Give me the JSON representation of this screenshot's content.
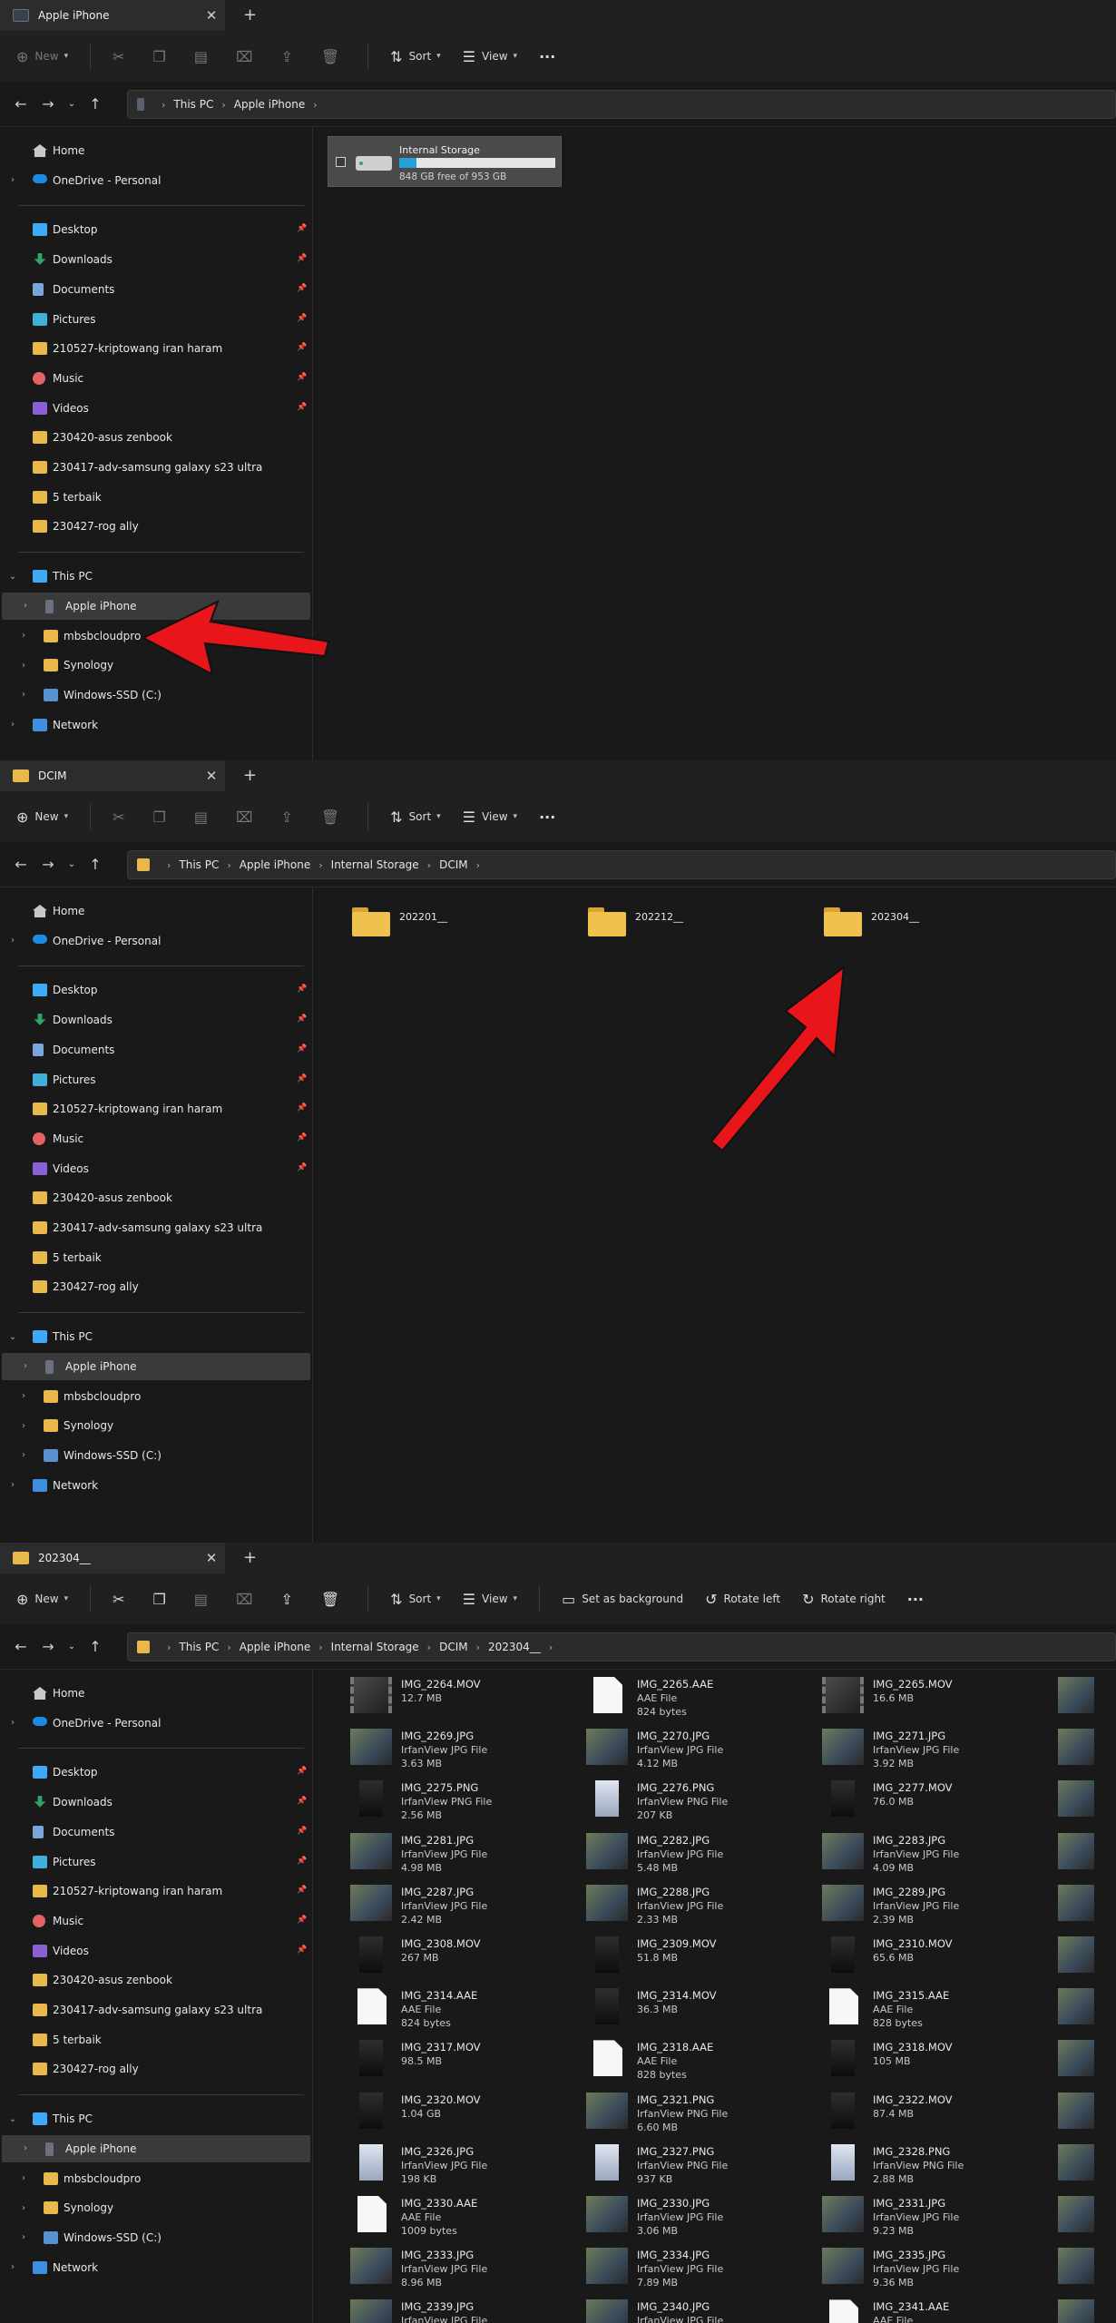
{
  "panels": [
    {
      "tab_title": "Apple iPhone",
      "breadcrumb": [
        "This PC",
        "Apple iPhone"
      ],
      "toolbar": {
        "new_label": "New",
        "sort_label": "Sort",
        "view_label": "View",
        "more_label": "···"
      },
      "drive": {
        "name": "Internal Storage",
        "free_text": "848 GB free of 953 GB",
        "used_fraction": 0.11
      },
      "selected_nav": "Apple iPhone"
    },
    {
      "tab_title": "DCIM",
      "breadcrumb": [
        "This PC",
        "Apple iPhone",
        "Internal Storage",
        "DCIM"
      ],
      "toolbar": {
        "new_label": "New",
        "sort_label": "Sort",
        "view_label": "View",
        "more_label": "···"
      },
      "folders": [
        "202201__",
        "202212__",
        "202304__"
      ],
      "selected_nav": "Apple iPhone"
    },
    {
      "tab_title": "202304__",
      "breadcrumb": [
        "This PC",
        "Apple iPhone",
        "Internal Storage",
        "DCIM",
        "202304__"
      ],
      "toolbar": {
        "new_label": "New",
        "sort_label": "Sort",
        "view_label": "View",
        "set_bg_label": "Set as background",
        "rotate_left_label": "Rotate left",
        "rotate_right_label": "Rotate right",
        "more_label": "···"
      },
      "selected_nav": "Apple iPhone",
      "files": [
        [
          {
            "name": "IMG_2264.MOV",
            "type": "",
            "size": "12.7 MB",
            "thumb": "video"
          },
          {
            "name": "IMG_2265.AAE",
            "type": "AAE File",
            "size": "824 bytes",
            "thumb": "doc"
          },
          {
            "name": "IMG_2265.MOV",
            "type": "",
            "size": "16.6 MB",
            "thumb": "video"
          }
        ],
        [
          {
            "name": "IMG_2269.JPG",
            "type": "IrfanView JPG File",
            "size": "3.63 MB",
            "thumb": "photo"
          },
          {
            "name": "IMG_2270.JPG",
            "type": "IrfanView JPG File",
            "size": "4.12 MB",
            "thumb": "photo"
          },
          {
            "name": "IMG_2271.JPG",
            "type": "IrfanView JPG File",
            "size": "3.92 MB",
            "thumb": "photo"
          }
        ],
        [
          {
            "name": "IMG_2275.PNG",
            "type": "IrfanView PNG File",
            "size": "2.56 MB",
            "thumb": "dark"
          },
          {
            "name": "IMG_2276.PNG",
            "type": "IrfanView PNG File",
            "size": "207 KB",
            "thumb": "screen"
          },
          {
            "name": "IMG_2277.MOV",
            "type": "",
            "size": "76.0 MB",
            "thumb": "dark"
          }
        ],
        [
          {
            "name": "IMG_2281.JPG",
            "type": "IrfanView JPG File",
            "size": "4.98 MB",
            "thumb": "photo"
          },
          {
            "name": "IMG_2282.JPG",
            "type": "IrfanView JPG File",
            "size": "5.48 MB",
            "thumb": "photo"
          },
          {
            "name": "IMG_2283.JPG",
            "type": "IrfanView JPG File",
            "size": "4.09 MB",
            "thumb": "photo"
          }
        ],
        [
          {
            "name": "IMG_2287.JPG",
            "type": "IrfanView JPG File",
            "size": "2.42 MB",
            "thumb": "photo"
          },
          {
            "name": "IMG_2288.JPG",
            "type": "IrfanView JPG File",
            "size": "2.33 MB",
            "thumb": "photo"
          },
          {
            "name": "IMG_2289.JPG",
            "type": "IrfanView JPG File",
            "size": "2.39 MB",
            "thumb": "photo"
          }
        ],
        [
          {
            "name": "IMG_2308.MOV",
            "type": "",
            "size": "267 MB",
            "thumb": "dark"
          },
          {
            "name": "IMG_2309.MOV",
            "type": "",
            "size": "51.8 MB",
            "thumb": "dark"
          },
          {
            "name": "IMG_2310.MOV",
            "type": "",
            "size": "65.6 MB",
            "thumb": "dark"
          }
        ],
        [
          {
            "name": "IMG_2314.AAE",
            "type": "AAE File",
            "size": "824 bytes",
            "thumb": "doc"
          },
          {
            "name": "IMG_2314.MOV",
            "type": "",
            "size": "36.3 MB",
            "thumb": "dark"
          },
          {
            "name": "IMG_2315.AAE",
            "type": "AAE File",
            "size": "828 bytes",
            "thumb": "doc"
          }
        ],
        [
          {
            "name": "IMG_2317.MOV",
            "type": "",
            "size": "98.5 MB",
            "thumb": "dark"
          },
          {
            "name": "IMG_2318.AAE",
            "type": "AAE File",
            "size": "828 bytes",
            "thumb": "doc"
          },
          {
            "name": "IMG_2318.MOV",
            "type": "",
            "size": "105 MB",
            "thumb": "dark"
          }
        ],
        [
          {
            "name": "IMG_2320.MOV",
            "type": "",
            "size": "1.04 GB",
            "thumb": "dark"
          },
          {
            "name": "IMG_2321.PNG",
            "type": "IrfanView PNG File",
            "size": "6.60 MB",
            "thumb": "photo"
          },
          {
            "name": "IMG_2322.MOV",
            "type": "",
            "size": "87.4 MB",
            "thumb": "dark"
          }
        ],
        [
          {
            "name": "IMG_2326.JPG",
            "type": "IrfanView JPG File",
            "size": "198 KB",
            "thumb": "screen"
          },
          {
            "name": "IMG_2327.PNG",
            "type": "IrfanView PNG File",
            "size": "937 KB",
            "thumb": "screen"
          },
          {
            "name": "IMG_2328.PNG",
            "type": "IrfanView PNG File",
            "size": "2.88 MB",
            "thumb": "screen"
          }
        ],
        [
          {
            "name": "IMG_2330.AAE",
            "type": "AAE File",
            "size": "1009 bytes",
            "thumb": "doc"
          },
          {
            "name": "IMG_2330.JPG",
            "type": "IrfanView JPG File",
            "size": "3.06 MB",
            "thumb": "photo"
          },
          {
            "name": "IMG_2331.JPG",
            "type": "IrfanView JPG File",
            "size": "9.23 MB",
            "thumb": "photo"
          }
        ],
        [
          {
            "name": "IMG_2333.JPG",
            "type": "IrfanView JPG File",
            "size": "8.96 MB",
            "thumb": "photo"
          },
          {
            "name": "IMG_2334.JPG",
            "type": "IrfanView JPG File",
            "size": "7.89 MB",
            "thumb": "photo"
          },
          {
            "name": "IMG_2335.JPG",
            "type": "IrfanView JPG File",
            "size": "9.36 MB",
            "thumb": "photo"
          }
        ],
        [
          {
            "name": "IMG_2339.JPG",
            "type": "IrfanView JPG File",
            "size": "",
            "thumb": "photo"
          },
          {
            "name": "IMG_2340.JPG",
            "type": "IrfanView JPG File",
            "size": "",
            "thumb": "photo"
          },
          {
            "name": "IMG_2341.AAE",
            "type": "AAE File",
            "size": "",
            "thumb": "doc"
          }
        ]
      ],
      "fourth_column_partial": true
    }
  ],
  "sidebar": {
    "quick": [
      {
        "label": "Home",
        "icon": "home-icon",
        "pinned": false,
        "expandable": false
      },
      {
        "label": "OneDrive - Personal",
        "icon": "cloud-icon",
        "pinned": false,
        "expandable": true
      }
    ],
    "pinned": [
      {
        "label": "Desktop",
        "icon": "desktop-icon"
      },
      {
        "label": "Downloads",
        "icon": "downloads-icon"
      },
      {
        "label": "Documents",
        "icon": "documents-icon"
      },
      {
        "label": "Pictures",
        "icon": "pictures-icon"
      },
      {
        "label": "210527-kriptowang iran haram",
        "icon": "folder-icon"
      },
      {
        "label": "Music",
        "icon": "music-icon"
      },
      {
        "label": "Videos",
        "icon": "videos-icon"
      },
      {
        "label": "230420-asus zenbook",
        "icon": "folder-icon",
        "unpinned": true
      },
      {
        "label": "230417-adv-samsung galaxy s23 ultra",
        "icon": "folder-icon",
        "unpinned": true
      },
      {
        "label": "5 terbaik",
        "icon": "folder-icon",
        "unpinned": true
      },
      {
        "label": "230427-rog ally",
        "icon": "folder-icon",
        "unpinned": true
      }
    ],
    "pc": [
      {
        "label": "This PC",
        "icon": "pc-icon",
        "level": 0,
        "expanded": true
      },
      {
        "label": "Apple iPhone",
        "icon": "phone-icon",
        "level": 1
      },
      {
        "label": "mbsbcloudpro",
        "icon": "folder-icon",
        "level": 1
      },
      {
        "label": "Synology",
        "icon": "folder-icon",
        "level": 1
      },
      {
        "label": "Windows-SSD (C:)",
        "icon": "drive-icon",
        "level": 1
      },
      {
        "label": "Network",
        "icon": "network-icon",
        "level": 0
      }
    ]
  },
  "colors": {
    "accent": "#26a0da",
    "annotation_arrow": "#e8161b",
    "folder": "#f1c14d",
    "selected_row": "#3a3a3a"
  }
}
